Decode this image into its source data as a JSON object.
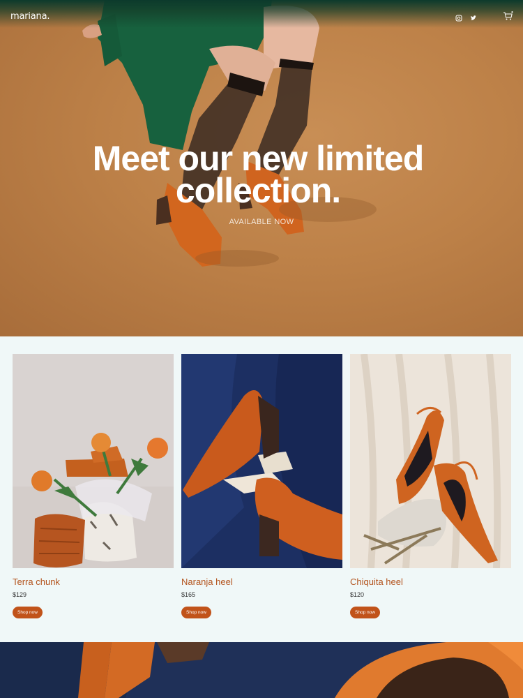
{
  "header": {
    "brand": "mariana.",
    "icons": [
      "instagram-icon",
      "twitter-icon",
      "cart-icon"
    ]
  },
  "hero": {
    "title_line1": "Meet our new limited",
    "title_line2": "collection.",
    "subtitle": "AVAILABLE NOW"
  },
  "products": [
    {
      "name": "Terra chunk",
      "price": "$129",
      "cta": "Shop now"
    },
    {
      "name": "Naranja heel",
      "price": "$165",
      "cta": "Shop now"
    },
    {
      "name": "Chiquita heel",
      "price": "$120",
      "cta": "Shop now"
    }
  ],
  "colors": {
    "accent": "#c1531a",
    "product_name": "#b3541e",
    "hero_bg": "#bd8148",
    "section_bg": "#f0f8f8"
  }
}
